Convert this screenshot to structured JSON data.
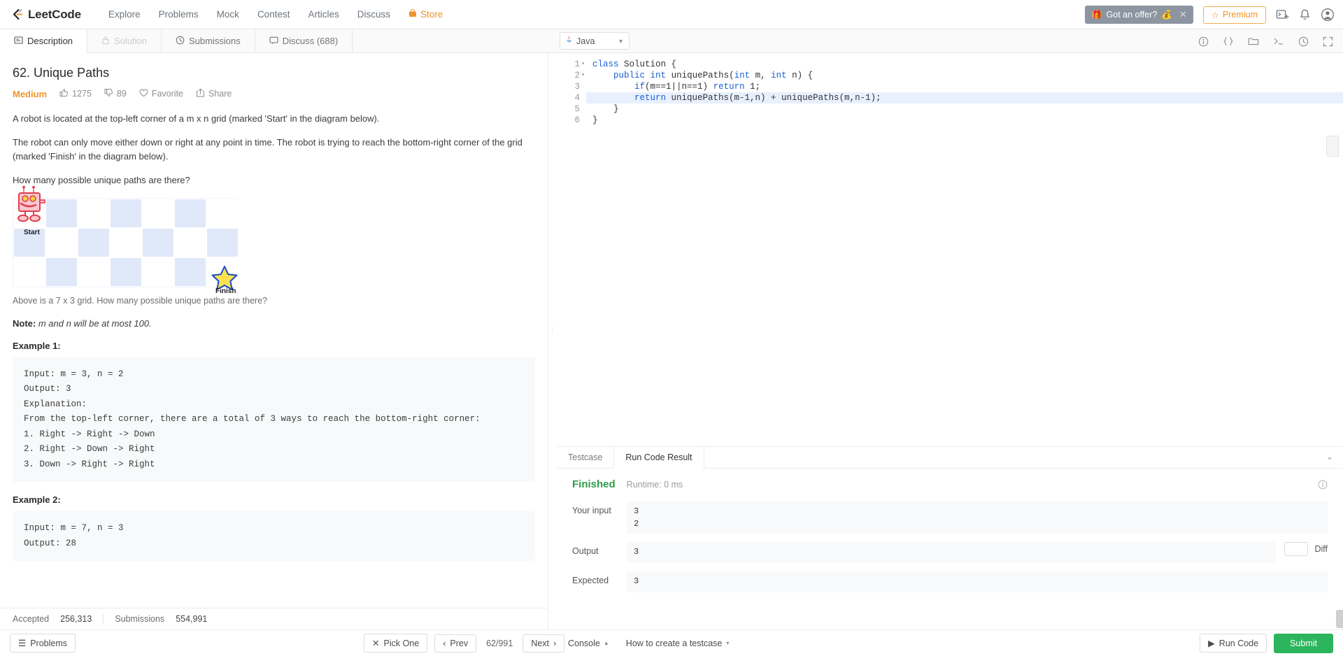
{
  "nav": {
    "brand": "LeetCode",
    "links": [
      {
        "label": "Explore",
        "name": "explore"
      },
      {
        "label": "Problems",
        "name": "problems"
      },
      {
        "label": "Mock",
        "name": "mock"
      },
      {
        "label": "Contest",
        "name": "contest"
      },
      {
        "label": "Articles",
        "name": "articles"
      },
      {
        "label": "Discuss",
        "name": "discuss"
      }
    ],
    "store_label": "Store",
    "offer_banner": "Got an offer?",
    "premium_label": "Premium",
    "icons": [
      "new-post-icon",
      "bell-icon",
      "user-avatar-icon"
    ]
  },
  "tabs": [
    {
      "label": "Description",
      "icon": "description-icon",
      "state": "active"
    },
    {
      "label": "Solution",
      "icon": "lock-icon",
      "state": "disabled"
    },
    {
      "label": "Submissions",
      "icon": "clock-icon",
      "state": "normal"
    },
    {
      "label": "Discuss (688)",
      "icon": "comment-icon",
      "state": "normal"
    }
  ],
  "language": {
    "selected": "Java",
    "icon": "java-icon"
  },
  "editor_tools": [
    "info-icon",
    "format-braces-icon",
    "folder-icon",
    "console-toggle-icon",
    "reset-icon",
    "fullscreen-icon"
  ],
  "problem": {
    "title": "62. Unique Paths",
    "difficulty": "Medium",
    "likes": "1275",
    "dislikes": "89",
    "favorite_label": "Favorite",
    "share_label": "Share",
    "paragraphs": [
      "A robot is located at the top-left corner of a m x n grid (marked 'Start' in the diagram below).",
      "The robot can only move either down or right at any point in time. The robot is trying to reach the bottom-right corner of the grid (marked 'Finish' in the diagram below).",
      "How many possible unique paths are there?"
    ],
    "diagram": {
      "start_label": "Start",
      "finish_label": "Finish",
      "cols": 7,
      "rows": 3
    },
    "caption": "Above is a 7 x 3 grid. How many possible unique paths are there?",
    "note_label": "Note:",
    "note_text": "m and n will be at most 100.",
    "examples": [
      {
        "heading": "Example 1:",
        "body": "Input: m = 3, n = 2\nOutput: 3\nExplanation:\nFrom the top-left corner, there are a total of 3 ways to reach the bottom-right corner:\n1. Right -> Right -> Down\n2. Right -> Down -> Right\n3. Down -> Right -> Right"
      },
      {
        "heading": "Example 2:",
        "body": "Input: m = 7, n = 3\nOutput: 28"
      }
    ],
    "stats": {
      "accepted_label": "Accepted",
      "accepted_value": "256,313",
      "submissions_label": "Submissions",
      "submissions_value": "554,991"
    }
  },
  "code": {
    "lines": [
      "class Solution {",
      "    public int uniquePaths(int m, int n) {",
      "        if(m==1||n==1) return 1;",
      "        return uniquePaths(m-1,n) + uniquePaths(m,n-1);",
      "    }",
      "}"
    ],
    "line_numbers": [
      "1",
      "2",
      "3",
      "4",
      "5",
      "6"
    ],
    "highlighted_line": 4,
    "fold_lines": [
      1,
      2
    ]
  },
  "result": {
    "tabs": [
      {
        "label": "Testcase",
        "active": false
      },
      {
        "label": "Run Code Result",
        "active": true
      }
    ],
    "status": "Finished",
    "runtime": "Runtime: 0 ms",
    "rows": [
      {
        "label": "Your input",
        "value": "3\n2"
      },
      {
        "label": "Output",
        "value": "3"
      },
      {
        "label": "Expected",
        "value": "3"
      }
    ],
    "diff_label": "Diff"
  },
  "bottombar": {
    "problems_label": "Problems",
    "pick_one_label": "Pick One",
    "prev_label": "Prev",
    "page_counter": "62/991",
    "next_label": "Next",
    "console_label": "Console",
    "howto_label": "How to create a testcase",
    "run_label": "Run Code",
    "submit_label": "Submit"
  },
  "colors": {
    "accent_orange": "#f0932b",
    "green": "#2db55d",
    "finished_green": "#2d9c4a",
    "grid_blue": "#dfe9fa",
    "highlight": "#e8f0fe"
  }
}
